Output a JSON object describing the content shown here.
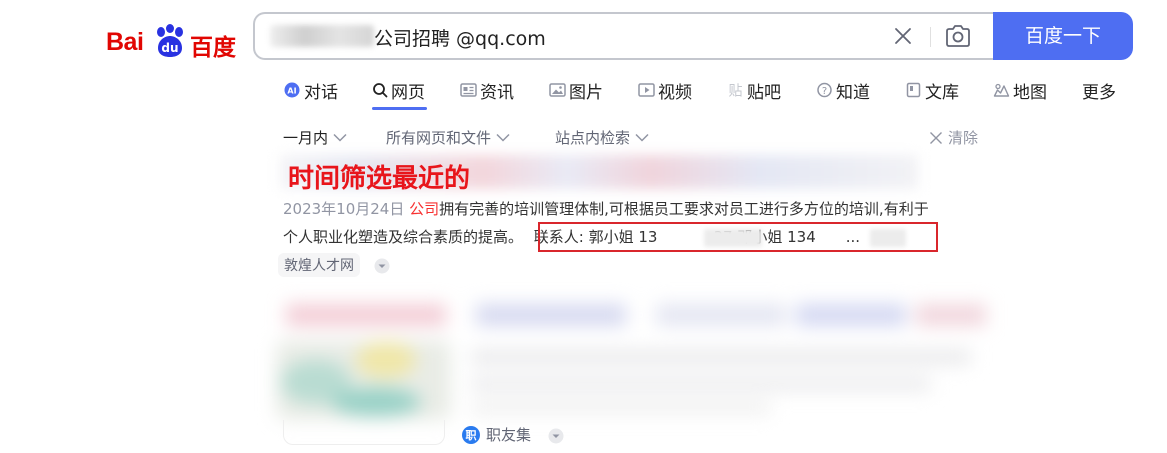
{
  "logo": {
    "bai": "Bai",
    "du_badge": "du",
    "baidu_cn": "百度"
  },
  "search": {
    "query_visible": "公司招聘 @qq.com",
    "button_label": "百度一下"
  },
  "tabs": [
    {
      "label": "对话",
      "icon": "ai-chat-icon"
    },
    {
      "label": "网页",
      "icon": "search-icon",
      "active": true
    },
    {
      "label": "资讯",
      "icon": "news-icon"
    },
    {
      "label": "图片",
      "icon": "image-icon"
    },
    {
      "label": "视频",
      "icon": "video-icon"
    },
    {
      "label": "贴吧",
      "icon": "tieba-icon"
    },
    {
      "label": "知道",
      "icon": "question-icon"
    },
    {
      "label": "文库",
      "icon": "document-icon"
    },
    {
      "label": "地图",
      "icon": "map-icon"
    },
    {
      "label": "更多",
      "icon": ""
    }
  ],
  "filters": {
    "time": "一月内",
    "type": "所有网页和文件",
    "site": "站点内检索",
    "clear": "清除"
  },
  "result1": {
    "annotation": "时间筛选最近的",
    "date": "2023年10月24日",
    "snippet_highlight": "公司",
    "snippet_line1_rest": "拥有完善的培训管理体制,可根据员工要求对员工进行多方位的培训,有利于",
    "snippet_line2_start": "个人职业化塑造及综合素质的提高。",
    "contact_a": "联系人: 郭小姐 13",
    "contact_b": "37 邓小姐 134",
    "contact_c": "...",
    "source": "敦煌人才网"
  },
  "result2": {
    "source": "职友集",
    "source_badge": "职"
  },
  "colors": {
    "brand_blue": "#4e6ef2",
    "highlight_red": "#f73131",
    "annotation_red": "#e8151b",
    "logo_red": "#e10602"
  }
}
